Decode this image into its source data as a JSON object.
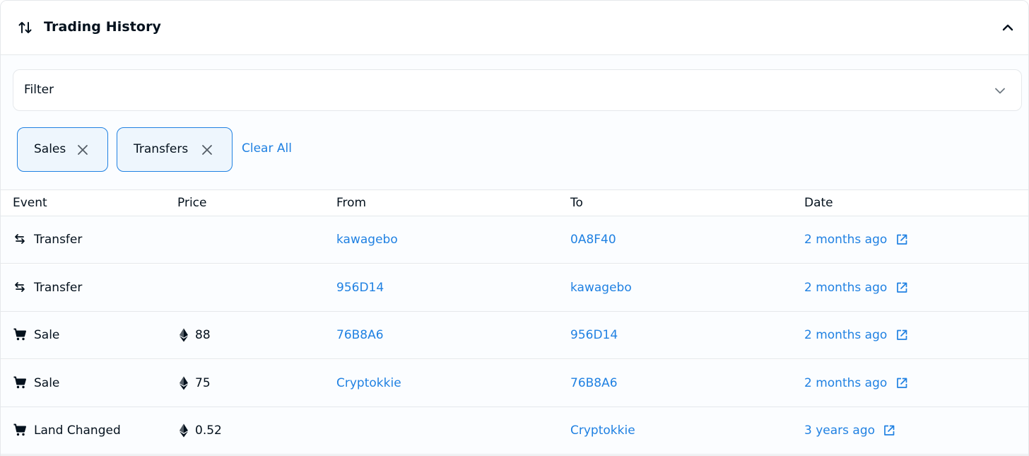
{
  "header": {
    "title": "Trading History",
    "icons": {
      "leading": "swap-vertical-icon",
      "collapse": "chevron-up-icon"
    }
  },
  "filter": {
    "label": "Filter",
    "icon": "chevron-down-icon"
  },
  "active_filters": [
    {
      "label": "Sales",
      "icon": "close-icon"
    },
    {
      "label": "Transfers",
      "icon": "close-icon"
    }
  ],
  "clear_all_label": "Clear All",
  "table": {
    "columns": [
      "Event",
      "Price",
      "From",
      "To",
      "Date"
    ],
    "rows": [
      {
        "event": "Transfer",
        "event_icon": "swap-horizontal-icon",
        "price": "",
        "from": "kawagebo",
        "to": "0A8F40",
        "date": "2 months ago"
      },
      {
        "event": "Transfer",
        "event_icon": "swap-horizontal-icon",
        "price": "",
        "from": "956D14",
        "to": "kawagebo",
        "date": "2 months ago"
      },
      {
        "event": "Sale",
        "event_icon": "cart-icon",
        "price": "88",
        "from": "76B8A6",
        "to": "956D14",
        "date": "2 months ago"
      },
      {
        "event": "Sale",
        "event_icon": "cart-icon",
        "price": "75",
        "from": "Cryptokkie",
        "to": "76B8A6",
        "date": "2 months ago"
      },
      {
        "event": "Land Changed",
        "event_icon": "cart-icon",
        "price": "0.52",
        "from": "",
        "to": "Cryptokkie",
        "date": "3 years ago"
      }
    ]
  },
  "colors": {
    "link": "#2081e2",
    "text": "#04111d",
    "border": "#e5e8eb",
    "pill_bg": "#eef6fd"
  }
}
